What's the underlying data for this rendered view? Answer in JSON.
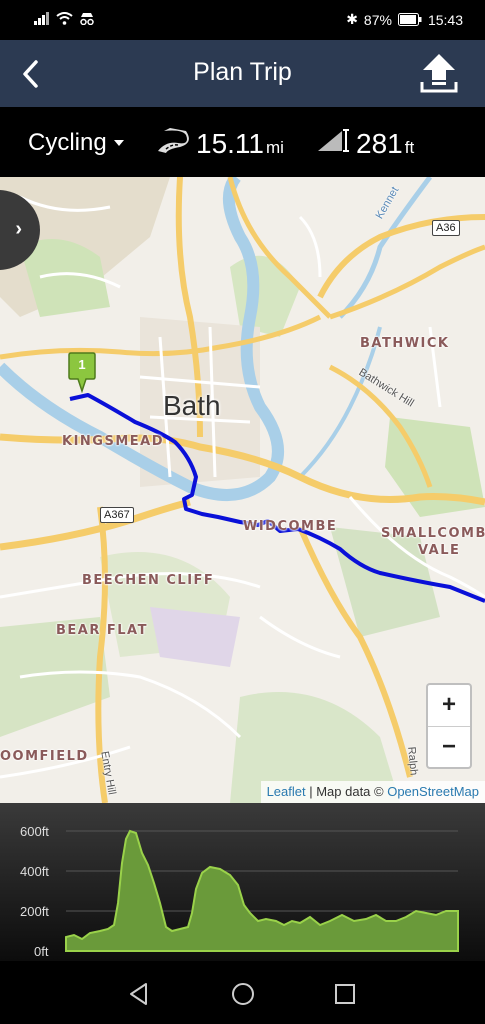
{
  "status_bar": {
    "battery": "87%",
    "time": "15:43"
  },
  "header": {
    "title": "Plan Trip"
  },
  "stats": {
    "mode": "Cycling",
    "distance_value": "15.11",
    "distance_unit": "mi",
    "climb_value": "281",
    "climb_unit": "ft"
  },
  "map": {
    "city": "Bath",
    "places": [
      "BATHWICK",
      "KINGSMEAD",
      "WIDCOMBE",
      "SMALLCOMBE",
      "VALE",
      "BEECHEN CLIFF",
      "BEAR FLAT",
      "OOMFIELD"
    ],
    "roads": [
      "A36",
      "A367"
    ],
    "streets": [
      "Bathwick Hill",
      "Entry Hill",
      "Ralph",
      "Kennet"
    ],
    "marker_label": "1",
    "route_color": "#0a10d8",
    "zoom_in_label": "+",
    "zoom_out_label": "−",
    "attribution": {
      "leaflet": "Leaflet",
      "separator": " | Map data © ",
      "osm": "OpenStreetMap"
    }
  },
  "elevation": {
    "y_ticks": [
      "600ft",
      "400ft",
      "200ft",
      "0ft"
    ],
    "fill_color": "#6a9a3a",
    "line_color": "#9ad24a"
  },
  "icons": {
    "back": "chevron-left-icon",
    "upload": "upload-icon",
    "distance": "road-icon",
    "climb": "climb-icon"
  }
}
